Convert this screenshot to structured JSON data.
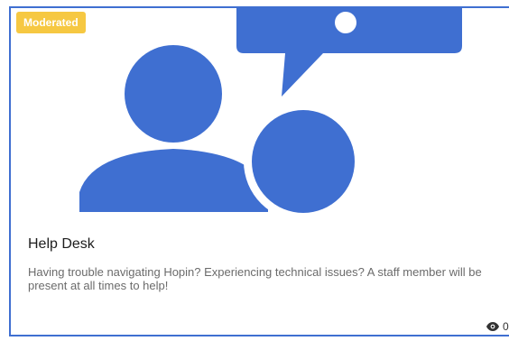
{
  "card": {
    "badge": "Moderated",
    "title": "Help Desk",
    "description": "Having trouble navigating Hopin? Experiencing technical issues? A staff member will be present at all times to help!",
    "views_icon": "eye-icon",
    "views_count": "0"
  },
  "colors": {
    "illustration": "#3f6fd1",
    "badge": "#f6c842",
    "border": "#3f6fd1"
  }
}
